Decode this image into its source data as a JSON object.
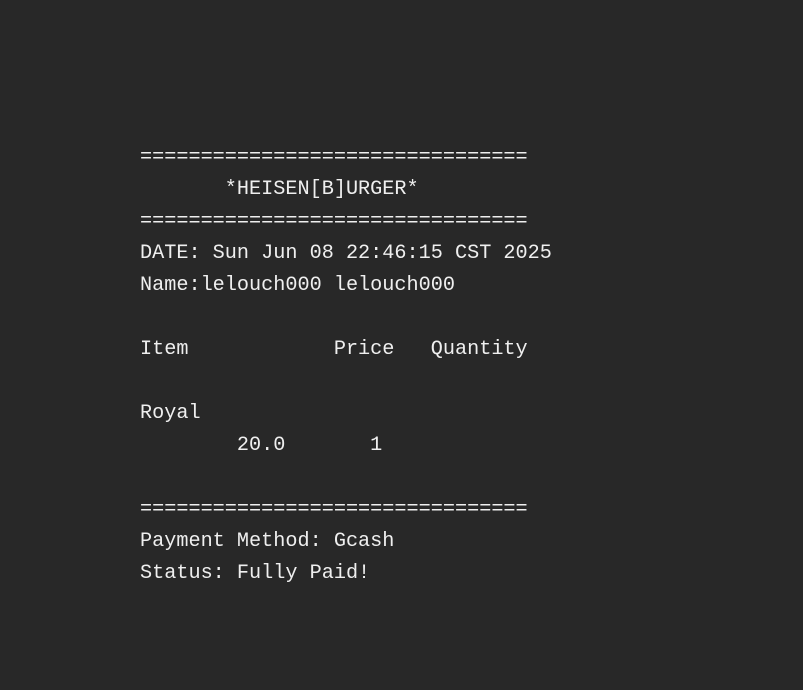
{
  "receipt": {
    "divider_top": "================================",
    "title": "       *HEISEN[B]URGER*",
    "divider_title": "================================",
    "date": "DATE: Sun Jun 08 22:46:15 CST 2025",
    "name": "Name:lelouch000 lelouch000",
    "header": "Item            Price   Quantity",
    "item_name": "Royal",
    "item_details": "        20.0       1",
    "divider_bottom": "================================",
    "payment": "Payment Method: Gcash",
    "status": "Status: Fully Paid!"
  }
}
